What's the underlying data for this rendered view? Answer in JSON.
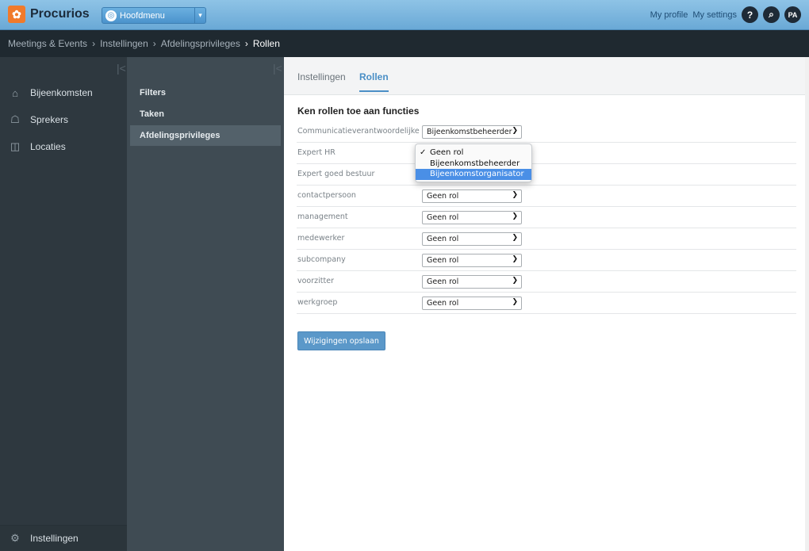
{
  "app": {
    "logo_text": "Procurios",
    "main_menu": "Hoofdmenu"
  },
  "topright": {
    "profile": "My profile",
    "settings": "My settings",
    "help": "?",
    "search_icon": "zoom-icon",
    "avatar": "PA"
  },
  "breadcrumb": {
    "items": [
      "Meetings & Events",
      "Instellingen",
      "Afdelingsprivileges"
    ],
    "current": "Rollen",
    "separator": "›"
  },
  "leftnav": {
    "collapse": "|<",
    "items": [
      {
        "label": "Bijeenkomsten",
        "icon": "audience-icon"
      },
      {
        "label": "Sprekers",
        "icon": "podium-icon"
      },
      {
        "label": "Locaties",
        "icon": "map-icon"
      }
    ],
    "bottom": {
      "label": "Instellingen",
      "icon": "gear-icon"
    }
  },
  "subnav": {
    "collapse": "|<",
    "items": [
      "Filters",
      "Taken",
      "Afdelingsprivileges"
    ],
    "active_index": 2
  },
  "tabs": [
    "Instellingen",
    "Rollen"
  ],
  "main": {
    "title": "Ken rollen toe aan functies",
    "rows": [
      {
        "label": "Communicatieverantwoordelijke",
        "value": "Bijeenkomstbeheerder"
      },
      {
        "label": "Expert HR",
        "value": "Geen rol"
      },
      {
        "label": "Expert goed bestuur",
        "value": "Geen rol"
      },
      {
        "label": "contactpersoon",
        "value": "Geen rol"
      },
      {
        "label": "management",
        "value": "Geen rol"
      },
      {
        "label": "medewerker",
        "value": "Geen rol"
      },
      {
        "label": "subcompany",
        "value": "Geen rol"
      },
      {
        "label": "voorzitter",
        "value": "Geen rol"
      },
      {
        "label": "werkgroep",
        "value": "Geen rol"
      }
    ],
    "save": "Wijzigingen opslaan"
  },
  "dropdown": {
    "options": [
      "Geen rol",
      "Bijeenkomstbeheerder",
      "Bijeenkomstorganisator"
    ],
    "checked_index": 0,
    "highlighted_index": 2
  },
  "colors": {
    "accent": "#4a8fc6",
    "logo": "#f07a2b",
    "nav_bg": "#2e383f"
  }
}
